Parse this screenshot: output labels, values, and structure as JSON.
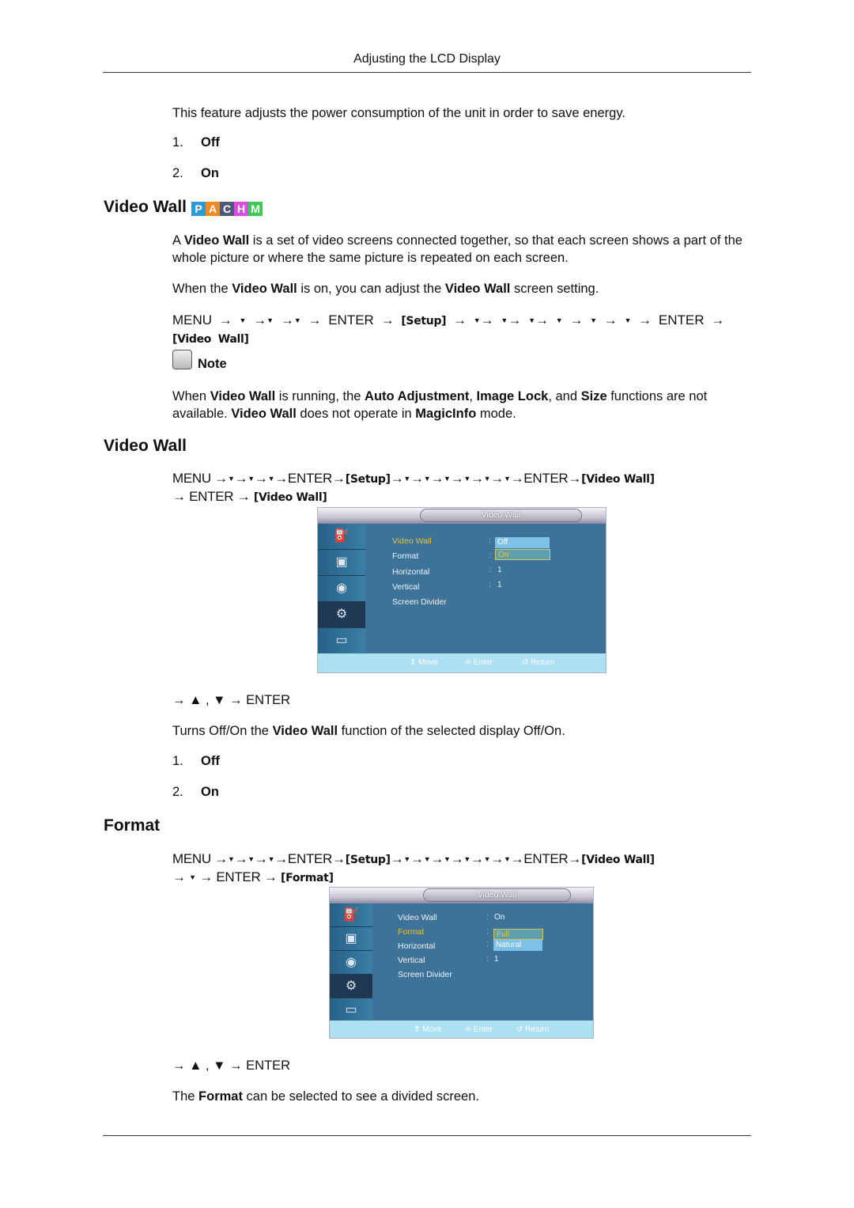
{
  "header": {
    "title": "Adjusting the LCD Display"
  },
  "intro": {
    "text": "This feature adjusts the power consumption of the unit in order to save energy.",
    "options": [
      {
        "num": "1.",
        "label": "Off"
      },
      {
        "num": "2.",
        "label": "On"
      }
    ]
  },
  "section1": {
    "heading": "Video Wall",
    "badges": [
      {
        "letter": "P",
        "color": "#2d9ad4"
      },
      {
        "letter": "A",
        "color": "#f08a24"
      },
      {
        "letter": "C",
        "color": "#4e5878"
      },
      {
        "letter": "H",
        "color": "#d84ee0"
      },
      {
        "letter": "M",
        "color": "#3ccb55"
      }
    ],
    "desc_parts": [
      "A ",
      "Video Wall",
      " is a set of video screens connected together, so that each screen shows a part of the whole picture or where the same picture is repeated on each screen."
    ],
    "when_parts": [
      "When the ",
      "Video Wall",
      " is on, you can adjust the ",
      "Video Wall",
      " screen setting."
    ],
    "menu_path": {
      "prefix": "MENU →",
      "down": "▼",
      "arrow": "→",
      "enter": "ENTER",
      "setup": "[Setup]",
      "target": "[Video Wall]"
    },
    "note": {
      "label": "Note",
      "parts": [
        "When ",
        "Video Wall",
        " is running, the ",
        "Auto Adjustment",
        ", ",
        "Image Lock",
        ", and ",
        "Size",
        " functions are not available. ",
        "Video Wall",
        " does not operate in ",
        "MagicInfo",
        " mode."
      ]
    }
  },
  "section2": {
    "heading": "Video Wall",
    "path_line2_enter": "ENTER",
    "target2": "[Video Wall]",
    "osd": {
      "title": "Video Wall",
      "rows": [
        {
          "label": "Video Wall",
          "value": ""
        },
        {
          "label": "Format",
          "value": ""
        },
        {
          "label": "Horizontal",
          "value": "1"
        },
        {
          "label": "Vertical",
          "value": "1"
        },
        {
          "label": "Screen Divider",
          "value": ""
        }
      ],
      "dropdown": [
        "Off",
        "On"
      ],
      "footer": [
        "⇕ Move",
        "⎆ Enter",
        "↺ Return"
      ]
    },
    "nav": "→ ▲ , ▼ → ENTER",
    "desc_parts": [
      "Turns Off/On the ",
      "Video Wall",
      " function of the selected display Off/On."
    ],
    "options": [
      {
        "num": "1.",
        "label": "Off"
      },
      {
        "num": "2.",
        "label": "On"
      }
    ]
  },
  "section3": {
    "heading": "Format",
    "target2": "[Format]",
    "osd": {
      "title": "Video Wall",
      "rows": [
        {
          "label": "Video Wall",
          "value": "On"
        },
        {
          "label": "Format",
          "value": ""
        },
        {
          "label": "Horizontal",
          "value": ""
        },
        {
          "label": "Vertical",
          "value": "1"
        },
        {
          "label": "Screen Divider",
          "value": ""
        }
      ],
      "dropdown": [
        "Full",
        "Natural"
      ],
      "footer": [
        "⇕ Move",
        "⎆ Enter",
        "↺ Return"
      ]
    },
    "nav": "→ ▲ , ▼ → ENTER",
    "desc_parts": [
      "The ",
      "Format",
      " can be selected to see a divided screen."
    ]
  },
  "icons": {
    "osd_sidebar": [
      "input-icon",
      "picture-icon",
      "sound-icon",
      "setup-icon",
      "multi-control-icon"
    ]
  }
}
